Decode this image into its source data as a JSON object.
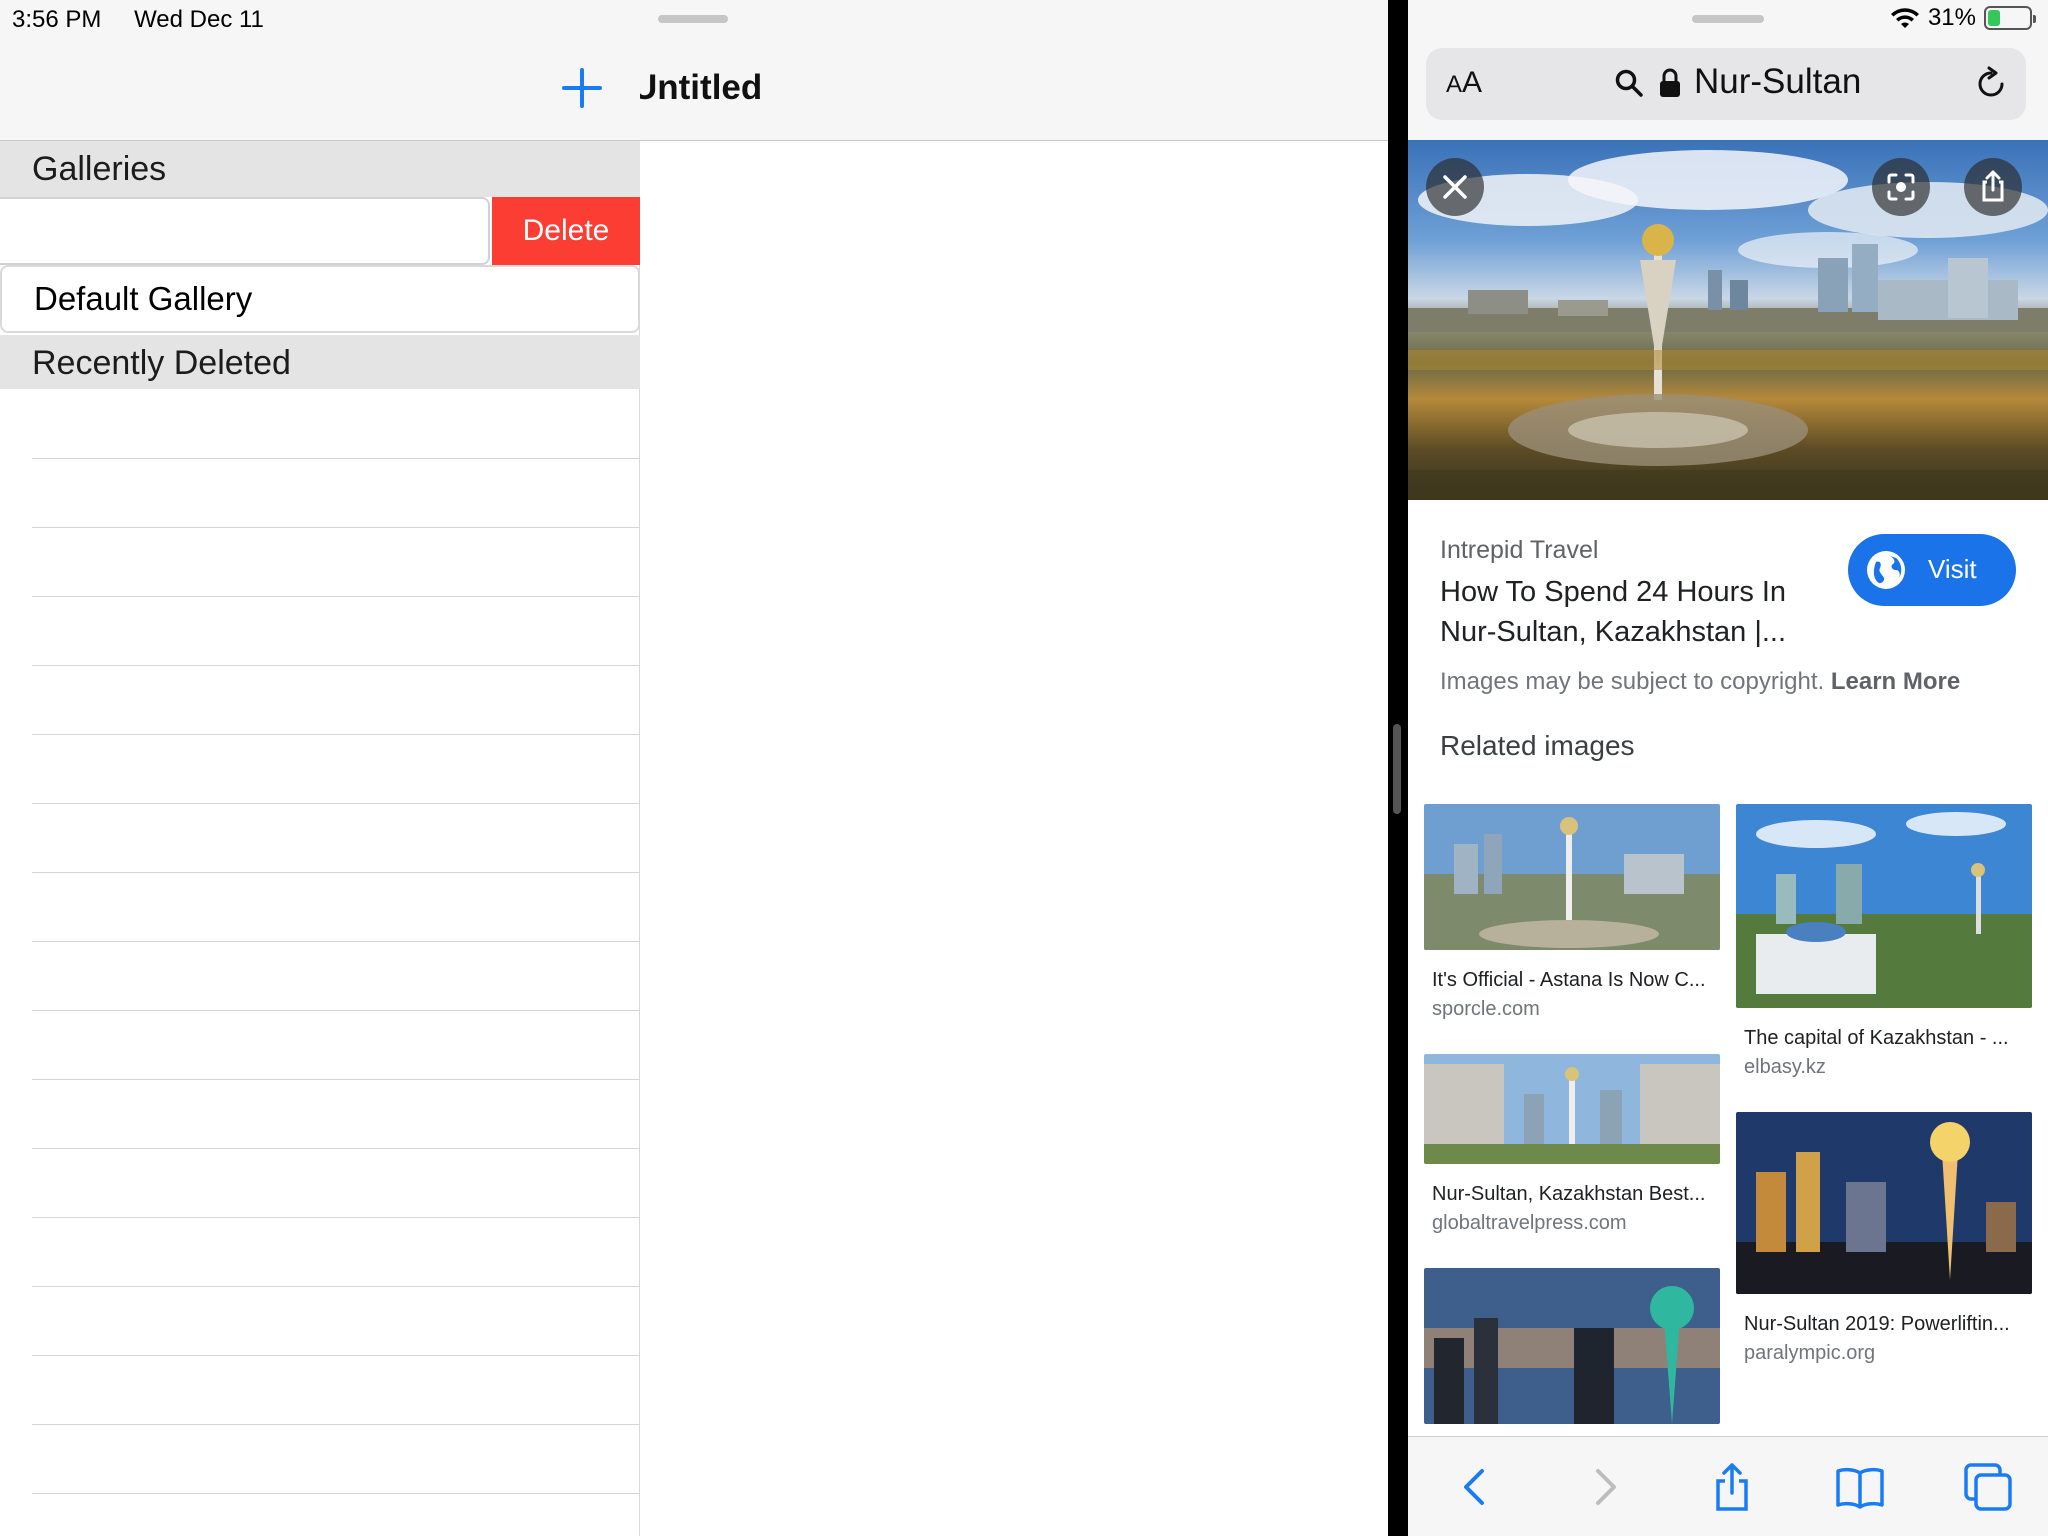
{
  "status_bar": {
    "time": "3:56 PM",
    "date": "Wed Dec 11",
    "battery": "31%",
    "battery_level": 0.31
  },
  "galleries_app": {
    "sections": {
      "galleries": "Galleries",
      "recently_deleted": "Recently Deleted"
    },
    "swipe_action": "Delete",
    "items": [
      "Default Gallery"
    ],
    "detail_title": "Untitled",
    "add_icon": "plus-icon"
  },
  "safari": {
    "text_size_label": "AA",
    "url": "Nur-Sultan",
    "icons": {
      "search": "search-icon",
      "lock": "lock-icon",
      "reload": "reload-icon"
    },
    "result": {
      "source": "Intrepid Travel",
      "title": "How To Spend 24 Hours In Nur-Sultan, Kazakhstan |...",
      "visit_label": "Visit",
      "copyright_text": "Images may be subject to copyright.",
      "learn_more": "Learn More"
    },
    "related_heading": "Related images",
    "related_images": [
      {
        "title": "It's Official - Astana Is Now C...",
        "source": "sporcle.com"
      },
      {
        "title": "The capital of Kazakhstan - ...",
        "source": "elbasy.kz"
      },
      {
        "title": "Nur-Sultan, Kazakhstan Best...",
        "source": "globaltravelpress.com"
      },
      {
        "title": "Nur-Sultan 2019: Powerliftin...",
        "source": "paralympic.org"
      },
      {
        "title": "",
        "source": ""
      }
    ],
    "toolbar": [
      "back-icon",
      "forward-icon",
      "share-icon",
      "bookmarks-icon",
      "tabs-icon"
    ],
    "colors": {
      "accent": "#1a73e8",
      "delete": "#fb3d33"
    }
  }
}
